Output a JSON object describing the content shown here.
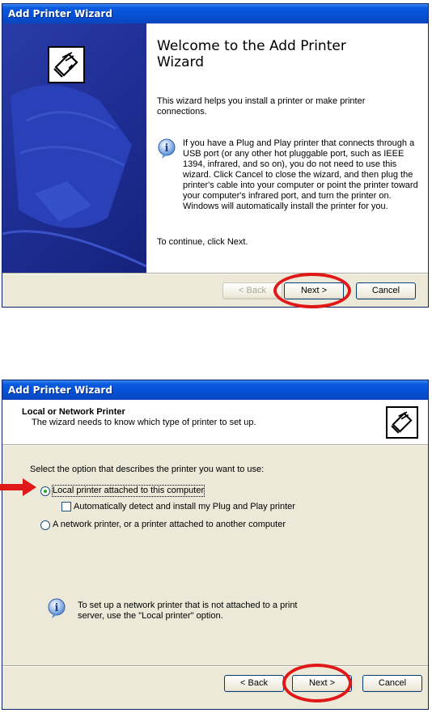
{
  "window1": {
    "title": "Add Printer Wizard",
    "heading_line1": "Welcome to the Add Printer",
    "heading_line2": "Wizard",
    "intro": "This wizard helps you install a printer or make printer connections.",
    "info": "If you have a Plug and Play printer that connects through a USB port (or any other hot pluggable port, such as IEEE 1394, infrared, and so on), you do not need to use this wizard. Click Cancel to close the wizard, and then plug the printer's cable into your computer or point the printer toward your computer's infrared port, and turn the printer on. Windows will automatically install the printer for you.",
    "continue": "To continue, click Next.",
    "buttons": {
      "back": "< Back",
      "next": "Next >",
      "cancel": "Cancel"
    }
  },
  "window2": {
    "title": "Add Printer Wizard",
    "header_title": "Local or Network Printer",
    "header_subtitle": "The wizard needs to know which type of printer to set up.",
    "prompt": "Select the option that describes the printer you want to use:",
    "options": [
      {
        "label": "Local printer attached to this computer",
        "selected": true
      },
      {
        "label": "Automatically detect and install my Plug and Play printer",
        "checked": false
      },
      {
        "label": "A network printer, or a printer attached to another computer",
        "selected": false
      }
    ],
    "info": "To set up a network printer that is not attached to a print server, use the \"Local printer\" option.",
    "buttons": {
      "back": "< Back",
      "next": "Next >",
      "cancel": "Cancel"
    }
  },
  "icons": [
    "printer-wizard-icon",
    "info-icon",
    "red-arrow-icon"
  ],
  "colors": {
    "title_bar": "#0a4fd6",
    "left_panel": "#1f2f96",
    "highlight": "#e01818",
    "dialog_bg": "#ece9d8"
  }
}
